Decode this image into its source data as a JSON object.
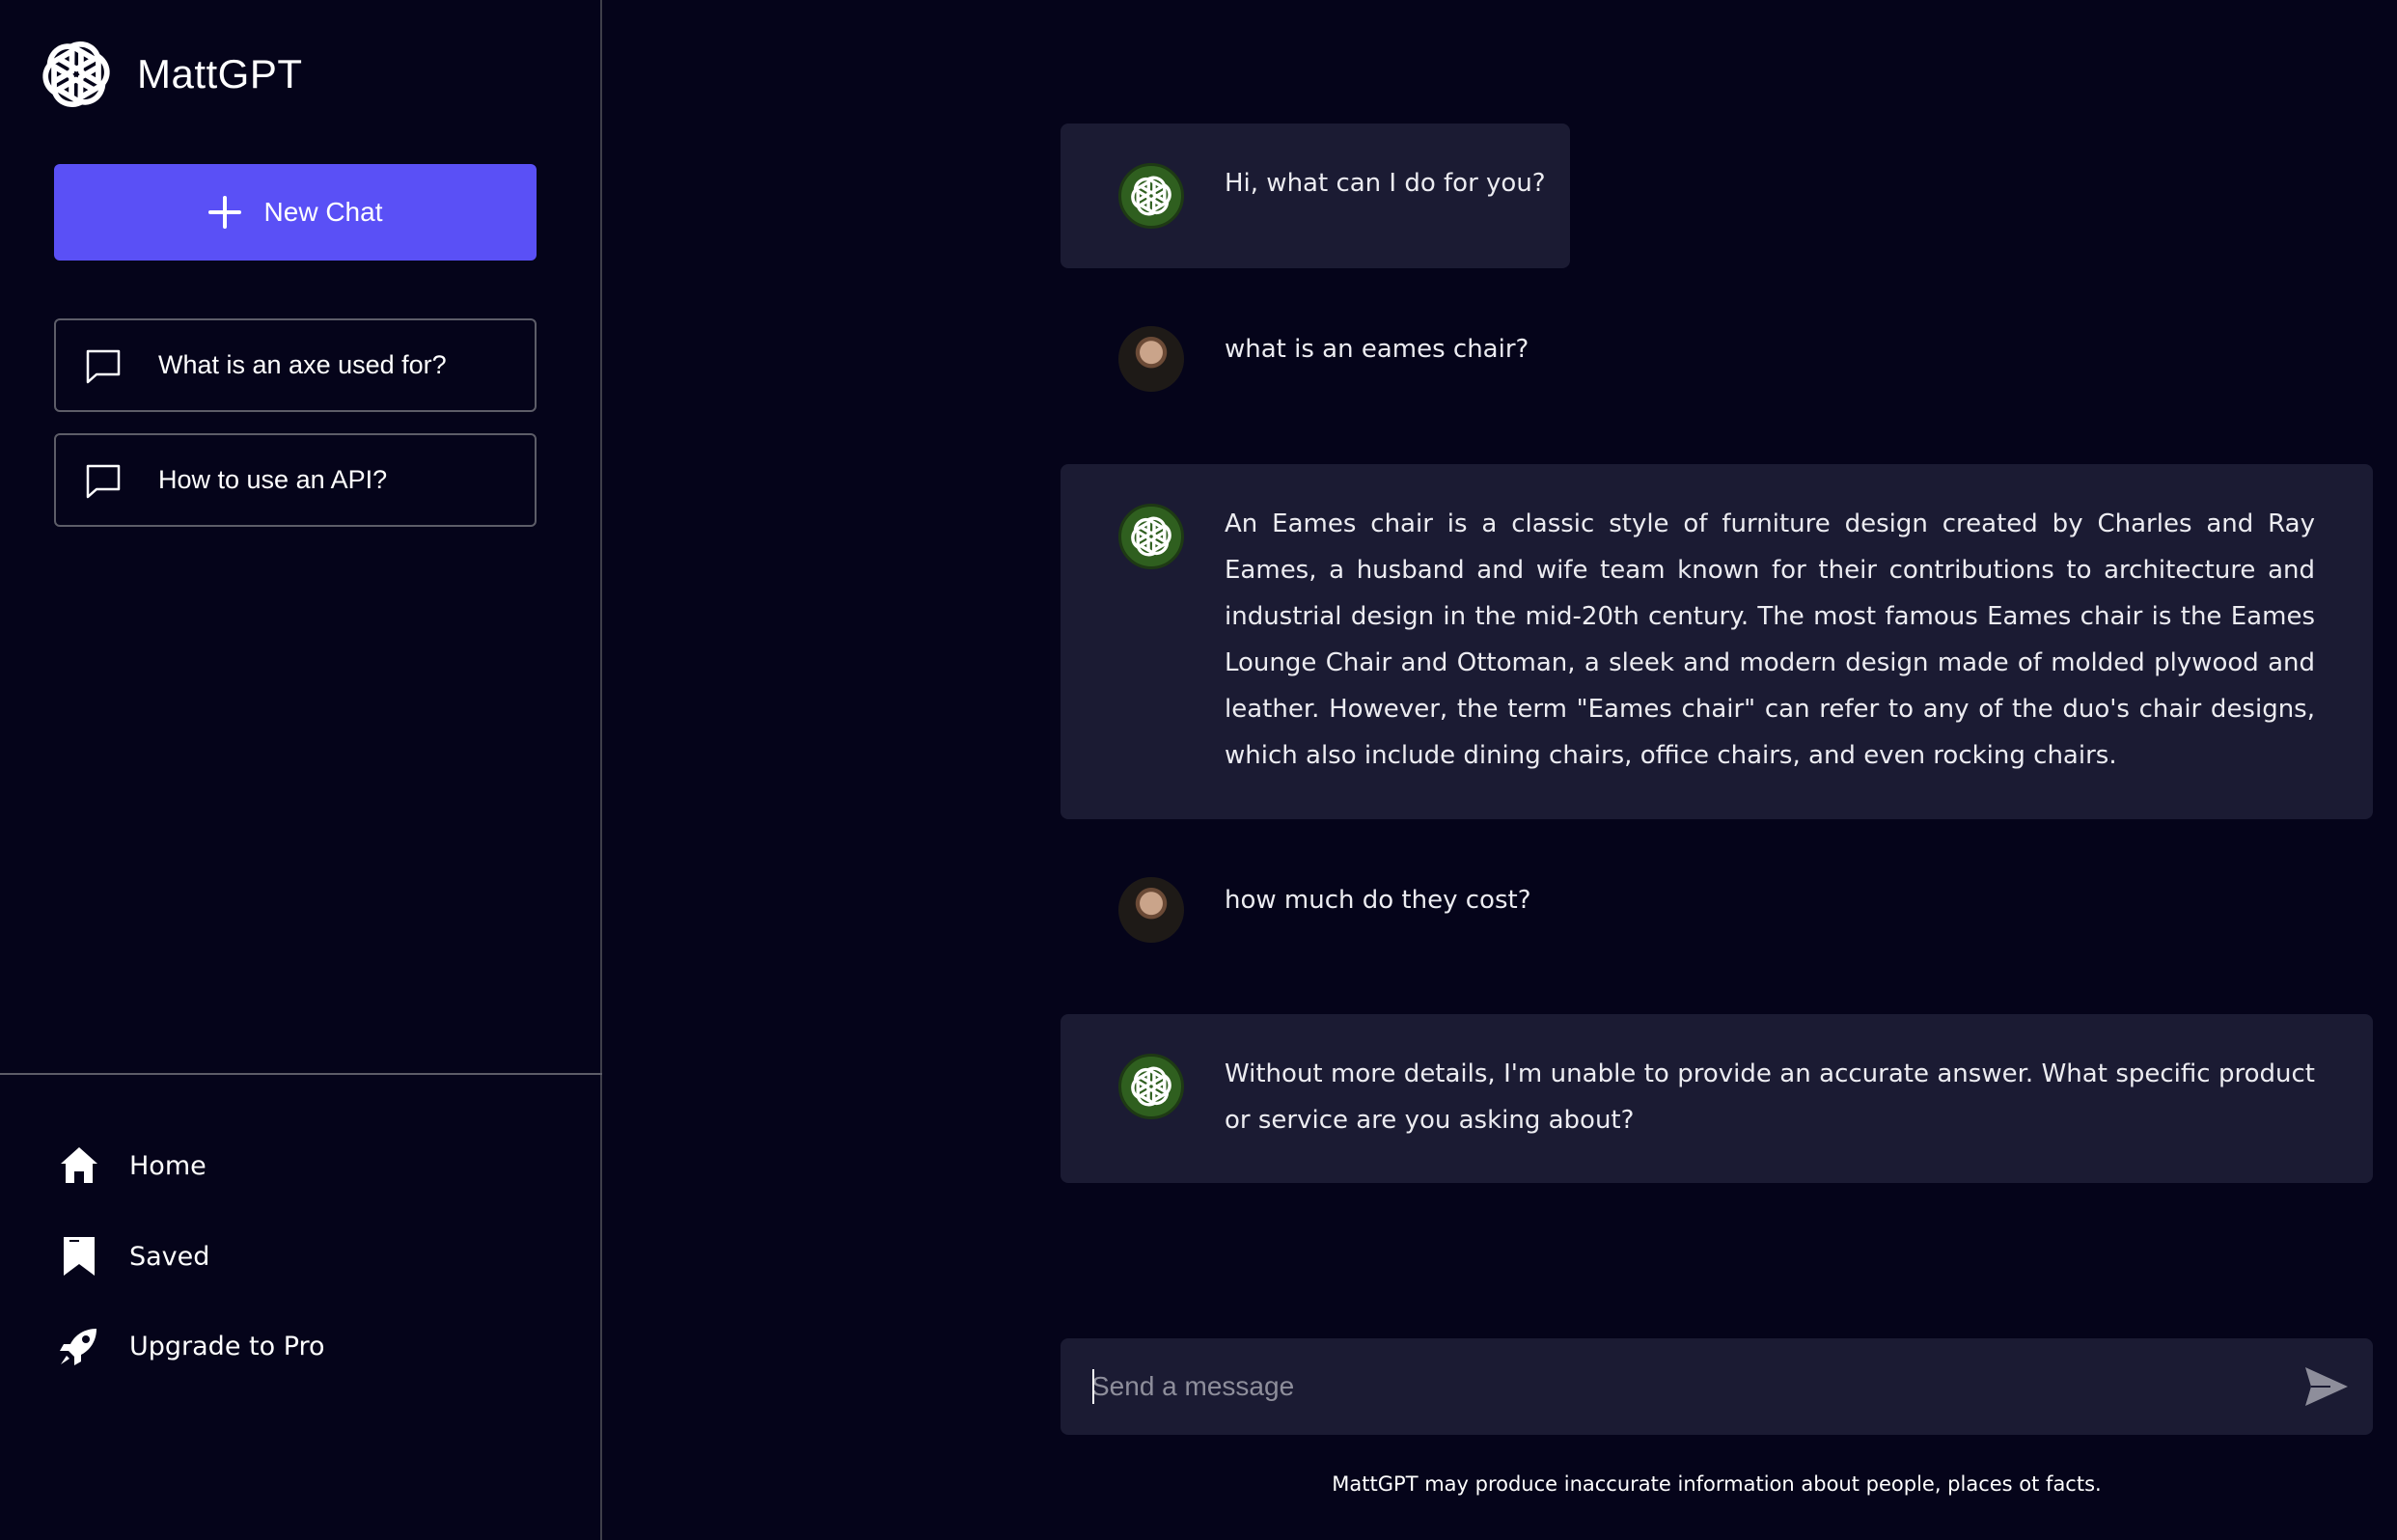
{
  "sidebar": {
    "brand": "MattGPT",
    "new_chat_label": "New Chat",
    "history": [
      {
        "label": "What is an axe used for?"
      },
      {
        "label": "How to use an API?"
      }
    ],
    "nav": [
      {
        "label": "Home",
        "icon": "home-icon"
      },
      {
        "label": "Saved",
        "icon": "bookmark-icon"
      },
      {
        "label": "Upgrade to Pro",
        "icon": "rocket-icon"
      }
    ]
  },
  "chat": {
    "messages": [
      {
        "role": "assistant",
        "text": "Hi, what can I do for you?"
      },
      {
        "role": "user",
        "text": "what is an eames chair?"
      },
      {
        "role": "assistant",
        "text": "An Eames chair is a classic style of furniture design created by Charles and Ray Eames, a husband and wife team known for their contributions to architecture and industrial design in the mid-20th century. The most famous Eames chair is the Eames Lounge Chair and Ottoman, a sleek and modern design made of molded plywood and leather. However, the term \"Eames chair\" can refer to any of the duo's chair designs, which also include dining chairs, office chairs, and even rocking chairs."
      },
      {
        "role": "user",
        "text": "how much do they cost?"
      },
      {
        "role": "assistant",
        "text": "Without more details, I'm unable to provide an accurate answer. What specific product or service are you asking about?"
      }
    ]
  },
  "composer": {
    "placeholder": "Send a message",
    "value": ""
  },
  "footer": {
    "disclaimer": "MattGPT may produce inaccurate information about people, places ot facts."
  },
  "colors": {
    "background": "#05041a",
    "bubble": "#1b1b33",
    "accent": "#5a50f6",
    "bot_avatar": "#2f5f1f"
  }
}
